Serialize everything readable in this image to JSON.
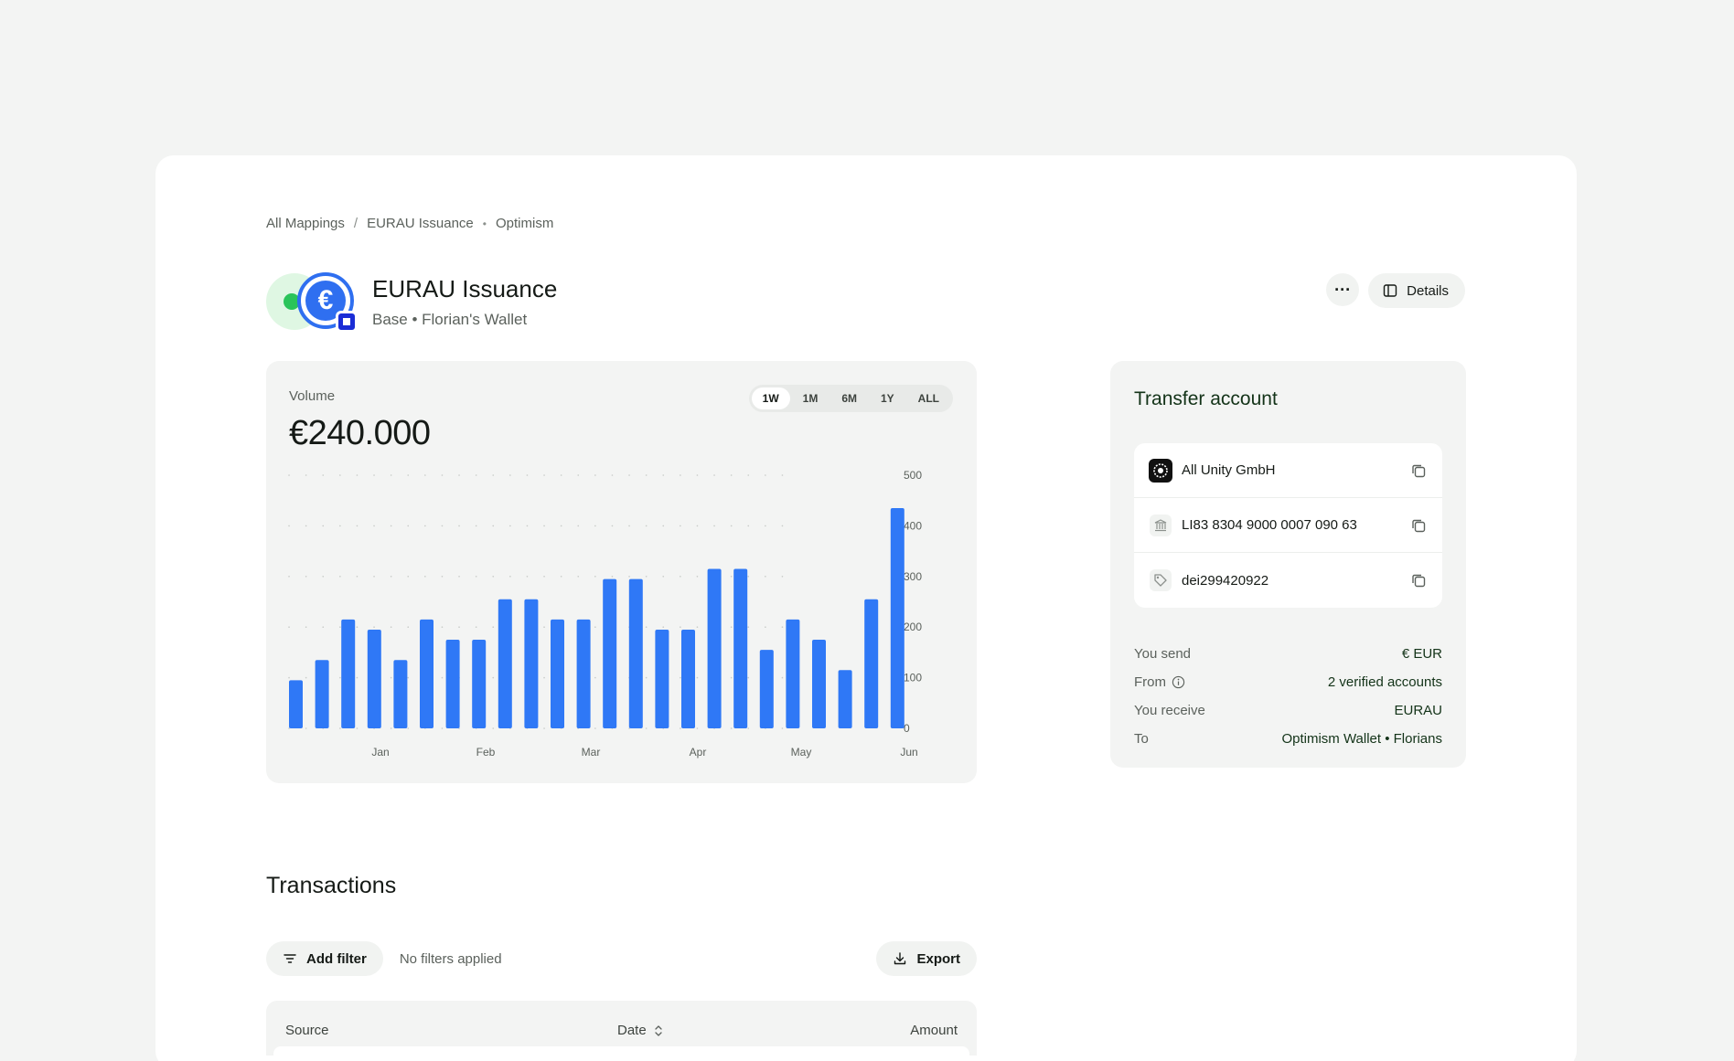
{
  "breadcrumb": {
    "items": [
      "All Mappings",
      "EURAU Issuance",
      "Optimism"
    ],
    "sep1": "/",
    "sep2": "•"
  },
  "header": {
    "title": "EURAU Issuance",
    "subtitle": "Base • Florian's Wallet",
    "more_label": "···",
    "details_label": "Details"
  },
  "volume": {
    "label": "Volume",
    "value": "€240.000",
    "ranges": [
      "1W",
      "1M",
      "6M",
      "1Y",
      "ALL"
    ],
    "active_range": "1W"
  },
  "chart_data": {
    "type": "bar",
    "x_tick_labels": [
      "Jan",
      "Feb",
      "Mar",
      "Apr",
      "May",
      "Jun"
    ],
    "values": [
      95,
      135,
      215,
      195,
      135,
      215,
      175,
      175,
      255,
      255,
      215,
      215,
      295,
      295,
      195,
      195,
      315,
      315,
      155,
      215,
      175,
      115,
      255,
      435
    ],
    "ylim": [
      0,
      500
    ],
    "yticks": [
      0,
      100,
      200,
      300,
      400,
      500
    ],
    "grid": "dotted",
    "bar_color": "#2f78f6"
  },
  "transfer": {
    "title": "Transfer account",
    "accounts": [
      {
        "icon": "company-logo-icon",
        "text": "All Unity GmbH"
      },
      {
        "icon": "bank-icon",
        "text": "LI83 8304 9000 0007 090 63"
      },
      {
        "icon": "tag-icon",
        "text": "dei299420922"
      }
    ],
    "summary": [
      {
        "key": "You send",
        "value": "€ EUR"
      },
      {
        "key": "From",
        "value": "2 verified accounts"
      },
      {
        "key": "You receive",
        "value": "EURAU"
      },
      {
        "key": "To",
        "value": "Optimism Wallet • Florians"
      }
    ]
  },
  "transactions": {
    "title": "Transactions",
    "add_filter_label": "Add filter",
    "no_filters_label": "No filters applied",
    "export_label": "Export",
    "columns": [
      "Source",
      "Date",
      "Amount"
    ]
  },
  "colors": {
    "accent_blue": "#2f6ff0",
    "dark_green_text": "#133318"
  }
}
